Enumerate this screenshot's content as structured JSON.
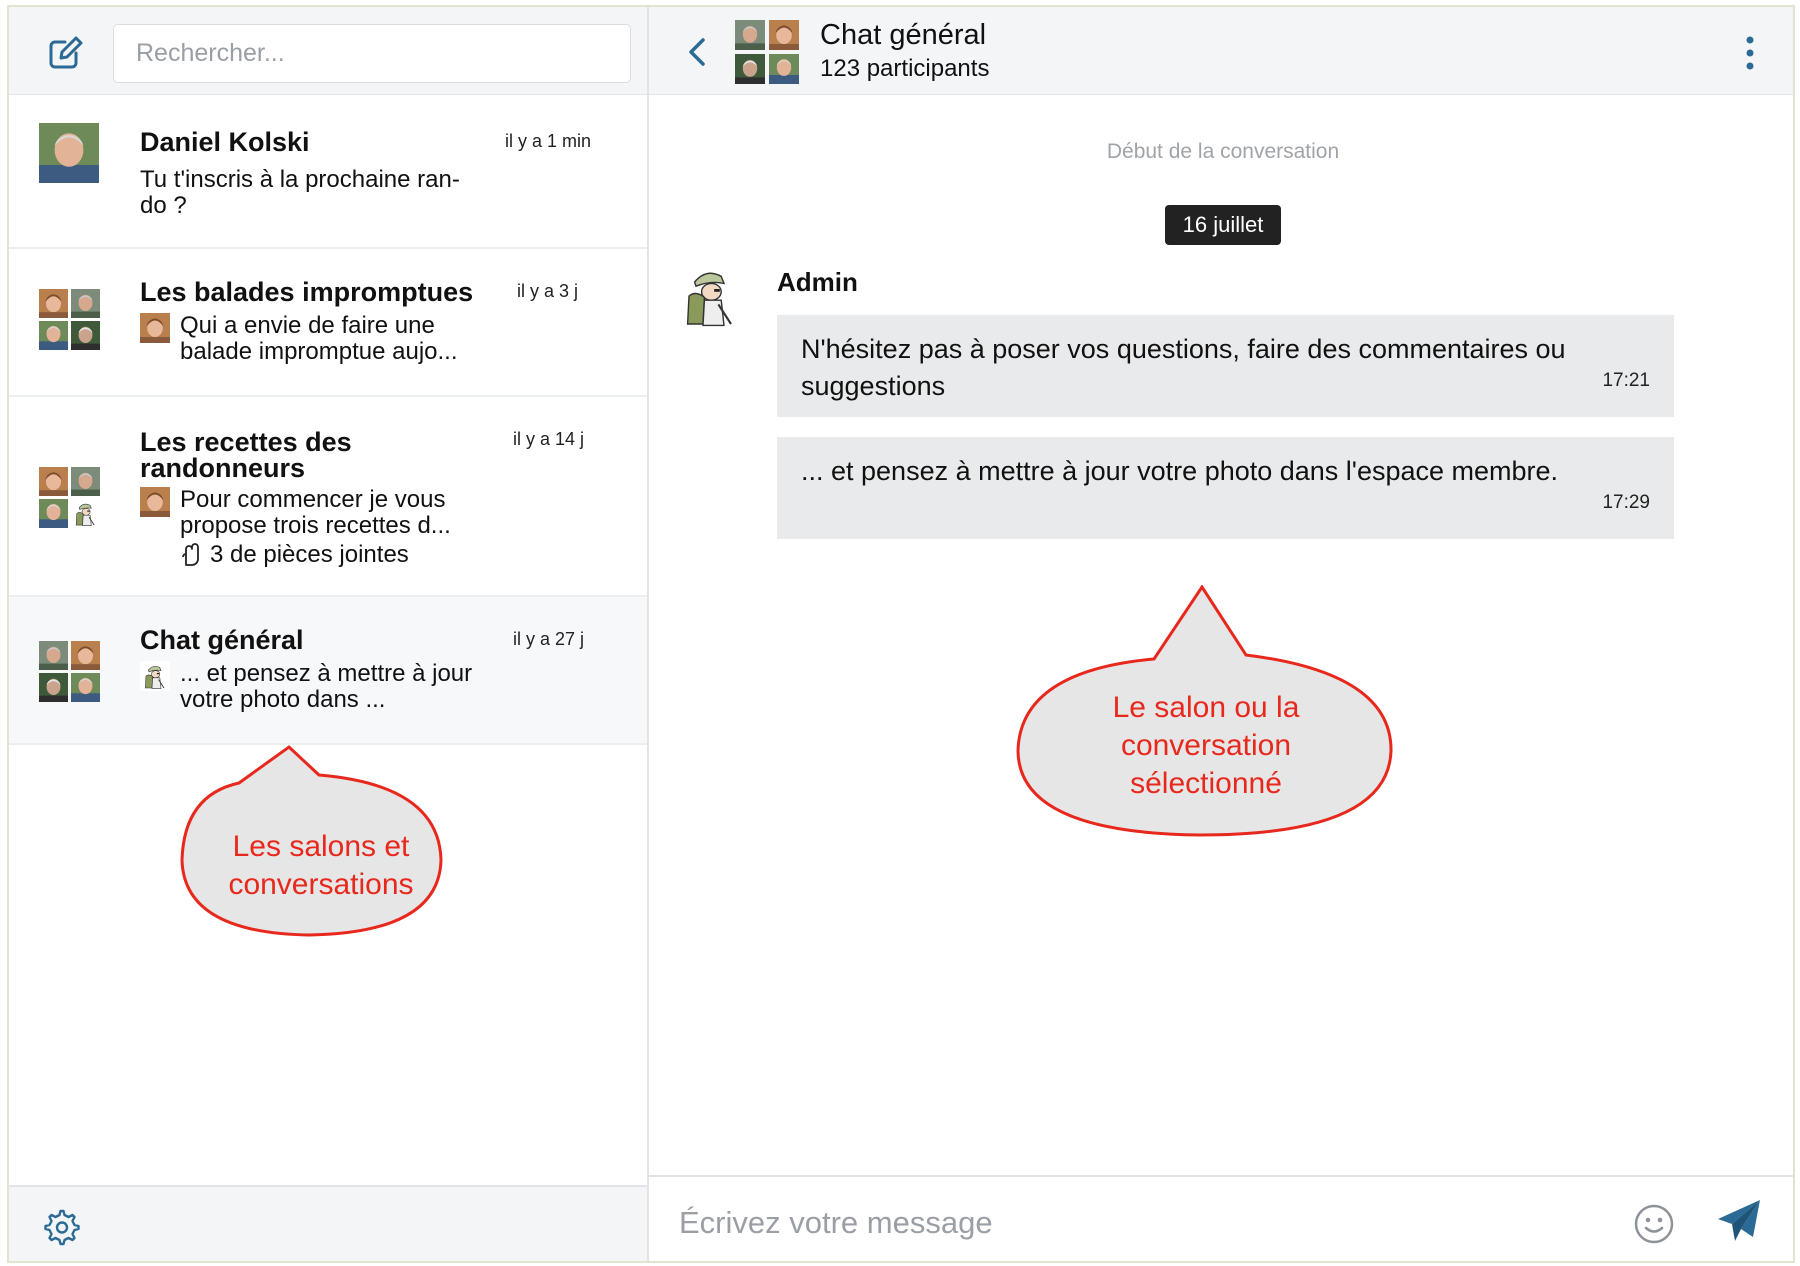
{
  "sidebar": {
    "search_placeholder": "Rechercher...",
    "conversations": [
      {
        "title": "Daniel Kolski",
        "time": "il y a 1 min",
        "preview": "Tu t'inscris à la prochaine ran-do ?"
      },
      {
        "title": "Les balades impromptues",
        "time": "il y a 3 j",
        "preview": "Qui a envie de faire une balade impromptue aujo..."
      },
      {
        "title": "Les recettes des randonneurs",
        "time": "il y a 14 j",
        "preview": "Pour commencer je vous propose trois recettes d...",
        "attachments": "3 de pièces jointes"
      },
      {
        "title": "Chat général",
        "time": "il y a 27 j",
        "preview": "... et pensez à mettre à jour votre photo dans ..."
      }
    ]
  },
  "header": {
    "title": "Chat général",
    "subtitle": "123 participants"
  },
  "chat": {
    "conversation_start": "Début de la conversation",
    "date": "16 juillet",
    "sender": "Admin",
    "messages": [
      {
        "text": "N'hésitez pas à poser vos questions, faire des commentaires ou suggestions",
        "time": "17:21"
      },
      {
        "text": "... et pensez à mettre à jour votre photo dans l'espace membre.",
        "time": "17:29"
      }
    ]
  },
  "composer": {
    "placeholder": "Écrivez votre message"
  },
  "annotations": {
    "left": "Les salons et conversations",
    "right": "Le salon ou la conversation sélectionné"
  },
  "colors": {
    "accent": "#2b6a95",
    "callout_text": "#e8281c",
    "callout_fill": "#e6e6e6",
    "bubble": "#e9eaeb"
  }
}
